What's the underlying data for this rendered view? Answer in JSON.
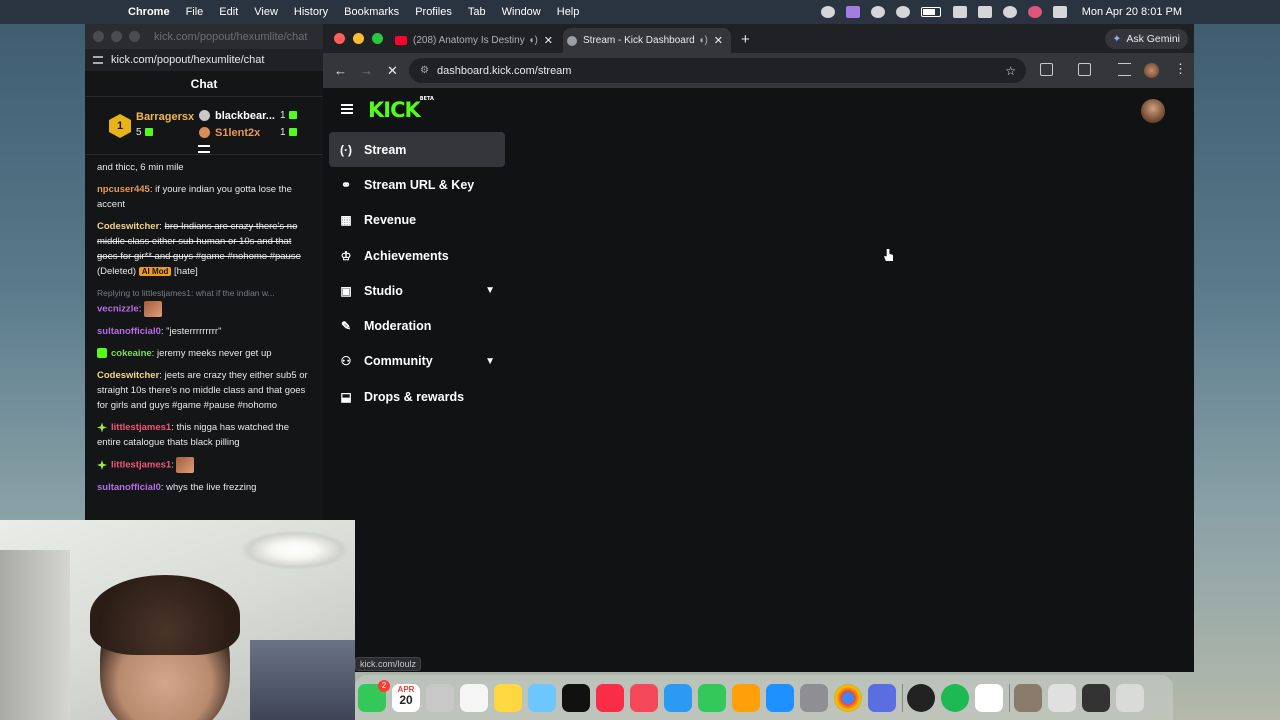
{
  "menubar": {
    "app": "Chrome",
    "items": [
      "File",
      "Edit",
      "View",
      "History",
      "Bookmarks",
      "Profiles",
      "Tab",
      "Window",
      "Help"
    ],
    "datetime": "Mon Apr 20  8:01 PM"
  },
  "chat_window": {
    "title": "kick.com/popout/hexumlite/chat",
    "url": "kick.com/popout/hexumlite/chat",
    "header": "Chat",
    "leaderboard": {
      "rank": "1",
      "first_name": "Barragersx",
      "first_count": "5",
      "second_name": "blackbear...",
      "second_count": "1",
      "third_name": "S1lent2x",
      "third_count": "1"
    },
    "messages": [
      {
        "user": "",
        "text": "and thicc, 6 min mile"
      },
      {
        "user": "npcuser445",
        "text": "if youre indian you gotta lose the accent"
      },
      {
        "user": "Codeswitcher",
        "text": "bro Indians are crazy there's no middle class either sub human or 10s and that goes for gir** and guys #game #nohomo #pause",
        "deleted": "(Deleted)",
        "tag": "AI Mod",
        "reason": "[hate]"
      },
      {
        "reply": "Replying to littlestjames1: what if the indian w...",
        "user": "vecnizzle",
        "text": ""
      },
      {
        "user": "sultanofficial0",
        "text": "\"jesterrrrrrrrr\""
      },
      {
        "user": "cokeaine",
        "text": "jeremy meeks never get up"
      },
      {
        "user": "Codeswitcher",
        "text": "jeets are crazy they either sub5 or straight 10s there's no middle class and that goes for girls and guys #game #pause #nohomo"
      },
      {
        "user": "littlestjames1",
        "text": "this nigga has watched the entire catalogue thats black pilling"
      },
      {
        "user": "littlestjames1",
        "text": ""
      },
      {
        "user": "sultanofficial0",
        "text": "whys the live frezzing"
      }
    ]
  },
  "browser": {
    "tabs": [
      {
        "title": "(208) Anatomy Is Destiny",
        "fav_color": "#ff0033"
      },
      {
        "title": "Stream - Kick Dashboard",
        "fav_color": "#9aa0a6"
      }
    ],
    "new_tab": "+",
    "gemini": "Ask Gemini",
    "url": "dashboard.kick.com/stream",
    "status_url": "kick.com/loulz"
  },
  "kick": {
    "logo": "KICK",
    "beta": "BETA",
    "accent": "#53fc18",
    "nav": [
      {
        "label": "Stream",
        "icon": "radio-icon",
        "glyph": "(·)",
        "active": true
      },
      {
        "label": "Stream URL & Key",
        "icon": "link-icon",
        "glyph": "⚭"
      },
      {
        "label": "Revenue",
        "icon": "chart-icon",
        "glyph": "▦"
      },
      {
        "label": "Achievements",
        "icon": "trophy-icon",
        "glyph": "♔"
      },
      {
        "label": "Studio",
        "icon": "studio-icon",
        "glyph": "▣",
        "expandable": true
      },
      {
        "label": "Moderation",
        "icon": "wrench-icon",
        "glyph": "✎"
      },
      {
        "label": "Community",
        "icon": "people-icon",
        "glyph": "⚇",
        "expandable": true
      },
      {
        "label": "Drops & rewards",
        "icon": "drops-icon",
        "glyph": "⬓"
      }
    ]
  },
  "dock": {
    "calendar_month": "APR",
    "calendar_day": "20",
    "messages_badge": "2"
  }
}
